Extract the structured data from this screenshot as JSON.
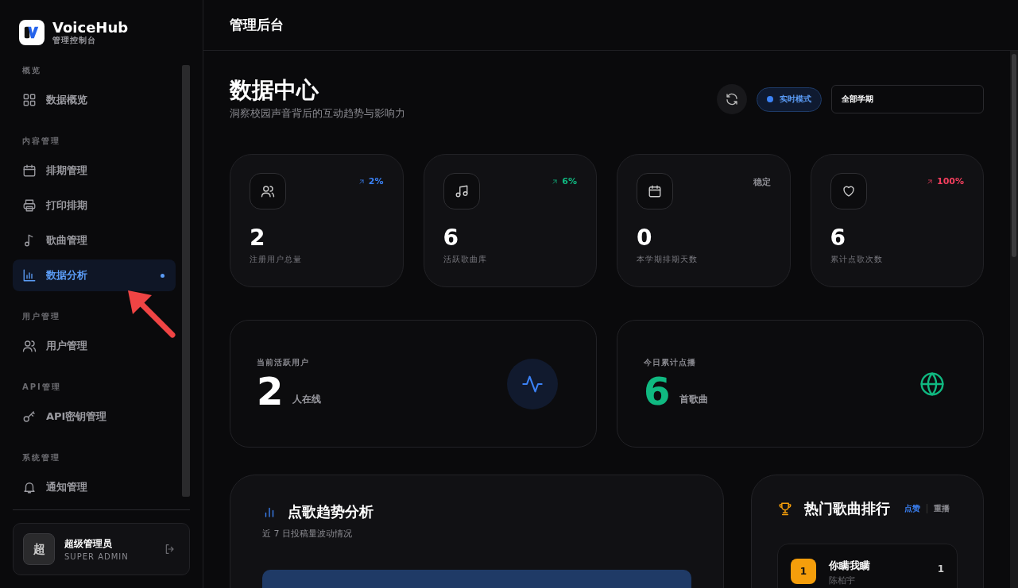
{
  "app": {
    "name": "VoiceHub",
    "subtitle": "管理控制台"
  },
  "sidebar": {
    "sections": [
      {
        "label": "概览",
        "items": [
          {
            "label": "数据概览",
            "selected": false
          }
        ]
      },
      {
        "label": "内容管理",
        "items": [
          {
            "label": "排期管理",
            "selected": false
          },
          {
            "label": "打印排期",
            "selected": false
          },
          {
            "label": "歌曲管理",
            "selected": false
          },
          {
            "label": "数据分析",
            "selected": true
          }
        ]
      },
      {
        "label": "用户管理",
        "items": [
          {
            "label": "用户管理",
            "selected": false
          }
        ]
      },
      {
        "label": "API管理",
        "items": [
          {
            "label": "API密钥管理",
            "selected": false
          }
        ]
      },
      {
        "label": "系统管理",
        "items": [
          {
            "label": "通知管理",
            "selected": false
          }
        ]
      }
    ]
  },
  "user": {
    "avatar": "超",
    "name": "超级管理员",
    "role": "SUPER ADMIN"
  },
  "header": {
    "title": "管理后台"
  },
  "page": {
    "title": "数据中心",
    "subtitle": "洞察校园声音背后的互动趋势与影响力",
    "live_mode": {
      "label": "实时模式",
      "on": true
    },
    "semester_select": {
      "value": "全部学期"
    }
  },
  "stats": [
    {
      "value": "2",
      "label": "注册用户总量",
      "trend": "2%",
      "kind": "up",
      "color": "#3b82f6"
    },
    {
      "value": "6",
      "label": "活跃歌曲库",
      "trend": "6%",
      "kind": "up",
      "color": "#10b981"
    },
    {
      "value": "0",
      "label": "本学期排期天数",
      "trend": "稳定",
      "kind": "stable",
      "color": "#8a8a90"
    },
    {
      "value": "6",
      "label": "累计点歌次数",
      "trend": "100%",
      "kind": "up",
      "color": "#f43f5e"
    }
  ],
  "live": [
    {
      "label": "当前活跃用户",
      "value": "2",
      "unit": "人在线",
      "color": "#ffffff"
    },
    {
      "label": "今日累计点播",
      "value": "6",
      "unit": "首歌曲",
      "color": "#10b981"
    }
  ],
  "trend_panel": {
    "title": "点歌趋势分析",
    "subtitle": "近 7 日投稿量波动情况"
  },
  "ranking": {
    "title": "热门歌曲排行",
    "tabs": [
      {
        "label": "点赞",
        "selected": true
      },
      {
        "label": "重播",
        "selected": false
      }
    ],
    "items": [
      {
        "rank": "1",
        "title": "你瞒我瞒",
        "artist": "陈柏宇",
        "count": "1"
      }
    ]
  }
}
